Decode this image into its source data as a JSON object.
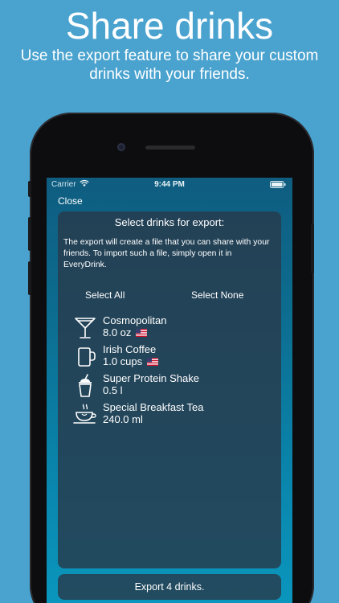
{
  "promo": {
    "title": "Share drinks",
    "subtitle": "Use the export feature to share your custom drinks with your friends."
  },
  "status_bar": {
    "carrier": "Carrier",
    "time": "9:44 PM"
  },
  "nav": {
    "close_label": "Close"
  },
  "export_panel": {
    "title": "Select drinks for export:",
    "description": "The export will create a file that you can share with your friends. To import such a file, simply open it in EveryDrink.",
    "select_all_label": "Select All",
    "select_none_label": "Select None"
  },
  "drinks": [
    {
      "name": "Cosmopolitan",
      "amount": "8.0 oz",
      "icon": "cocktail-glass-icon",
      "flag": "us-flag-icon"
    },
    {
      "name": "Irish Coffee",
      "amount": "1.0 cups",
      "icon": "mug-icon",
      "flag": "us-flag-icon"
    },
    {
      "name": "Super Protein Shake",
      "amount": "0.5 l",
      "icon": "shake-cup-icon",
      "flag": ""
    },
    {
      "name": "Special Breakfast Tea",
      "amount": "240.0 ml",
      "icon": "teacup-icon",
      "flag": ""
    }
  ],
  "export_button_label": "Export 4 drinks.",
  "colors": {
    "background": "#4aa3cf",
    "panel": "#283a4c",
    "text": "#ffffff"
  }
}
